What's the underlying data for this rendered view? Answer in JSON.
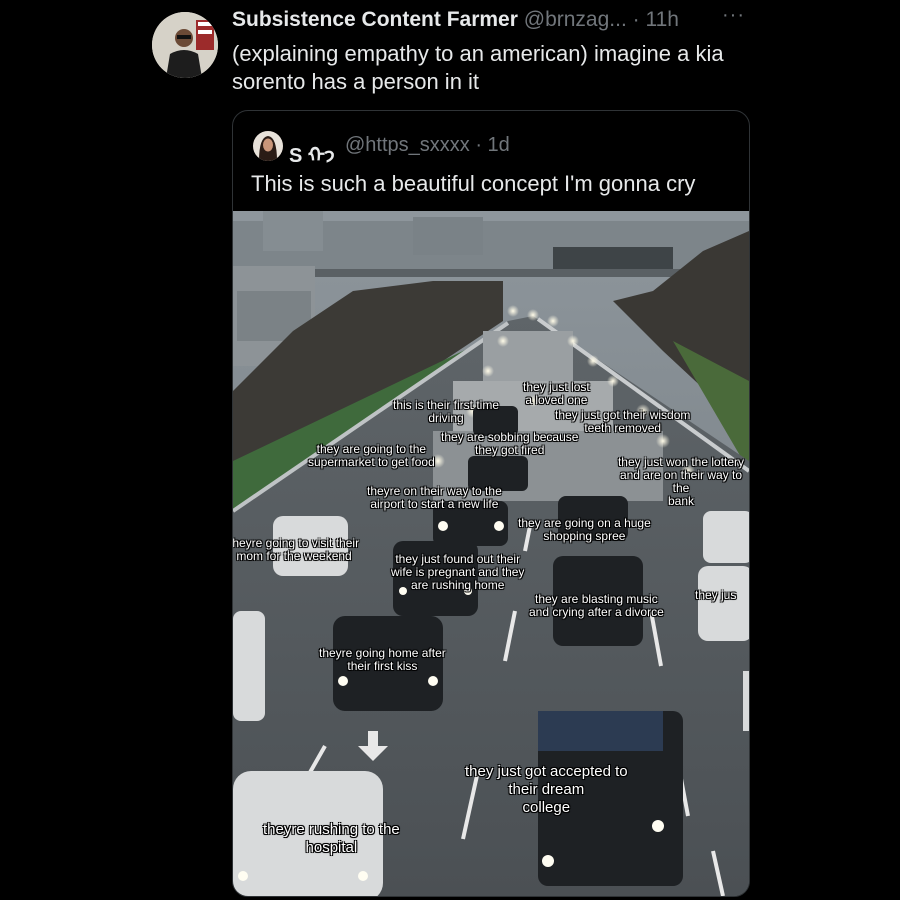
{
  "tweet": {
    "author_name": "Subsistence Content Farmer",
    "author_handle": "@brnzag...",
    "time": "· 11h",
    "more": "···",
    "text": "(explaining empathy to an american) imagine a kia sorento has a person in it"
  },
  "quoted_tweet": {
    "author_name": "S ᡣ𐭩",
    "author_handle": "@https_sxxxx · 1d",
    "text": "This is such a beautiful concept I'm gonna cry"
  },
  "captions": [
    "they just lost\na loved one",
    "this is their first time\ndriving",
    "they just got their wisdom\nteeth removed",
    "they are sobbing because\nthey got fired",
    "they are going to the\nsupermarket to get food",
    "they just won the lottery\nand are on their way to the\nbank",
    "theyre on their way to the\nairport to start a new life",
    "they are going on a huge\nshopping spree",
    "theyre going to visit their\nmom for the weekend",
    "they just found out their\nwife is pregnant and they\nare rushing home",
    "they are blasting music\nand crying after a divorce",
    "they jus",
    "theyre going home after\ntheir first kiss",
    "they just got accepted to\ntheir dream\ncollege",
    "theyre rushing to the\nhospital"
  ],
  "colors": {
    "background": "#000000",
    "text": "#e7e9ea",
    "muted": "#71767b",
    "border": "#2f3336"
  }
}
